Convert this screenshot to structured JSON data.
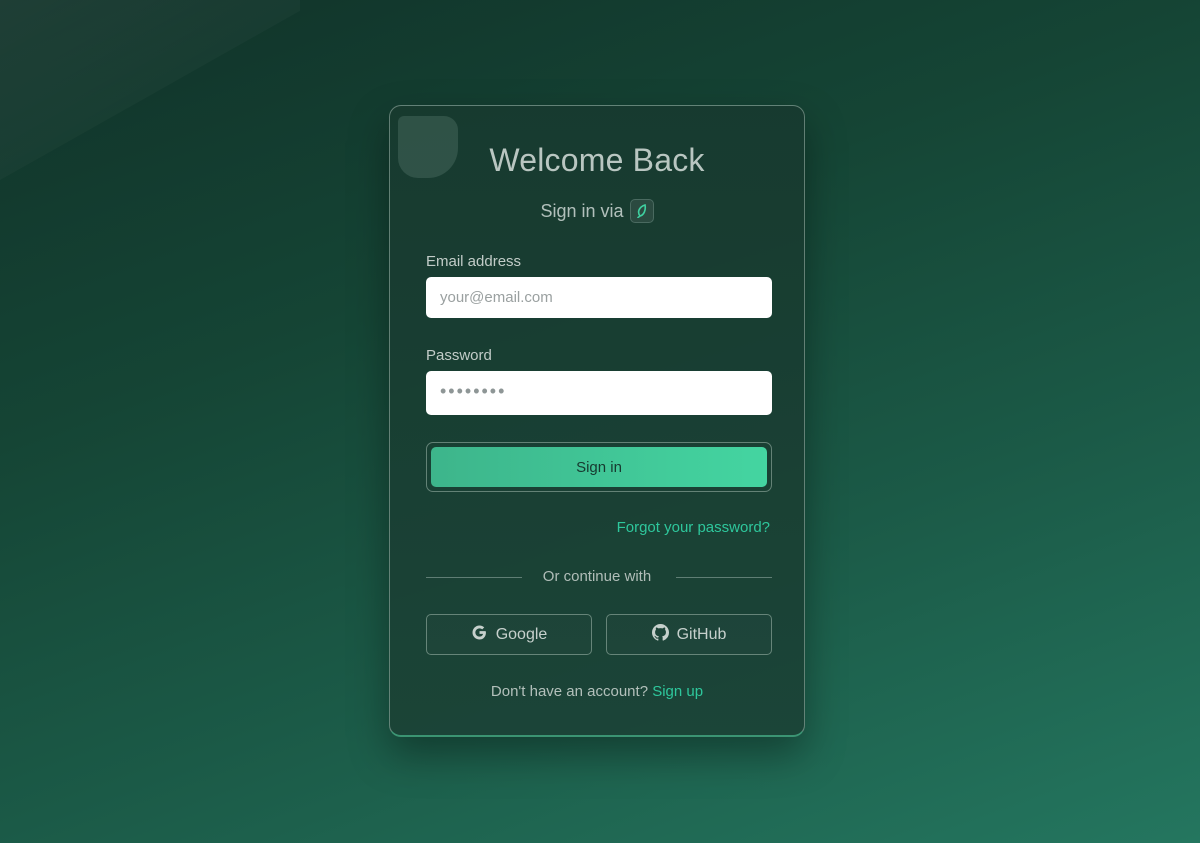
{
  "login": {
    "title": "Welcome Back",
    "subtitle": "Sign in via",
    "brand_icon": "leaf-icon",
    "email_label": "Email address",
    "email_placeholder": "your@email.com",
    "password_label": "Password",
    "password_value": "••••••••",
    "submit_label": "Sign in",
    "forgot_label": "Forgot your password?",
    "divider_text": "Or continue with",
    "google_label": "Google",
    "github_label": "GitHub",
    "signup_prompt": "Don't have an account?",
    "signup_label": "Sign up"
  },
  "colors": {
    "accent": "#2ec79c",
    "button_gradient_start": "#3db58b",
    "button_gradient_end": "#44d5a1",
    "background_dark": "#113229",
    "background_light": "#24765f"
  }
}
